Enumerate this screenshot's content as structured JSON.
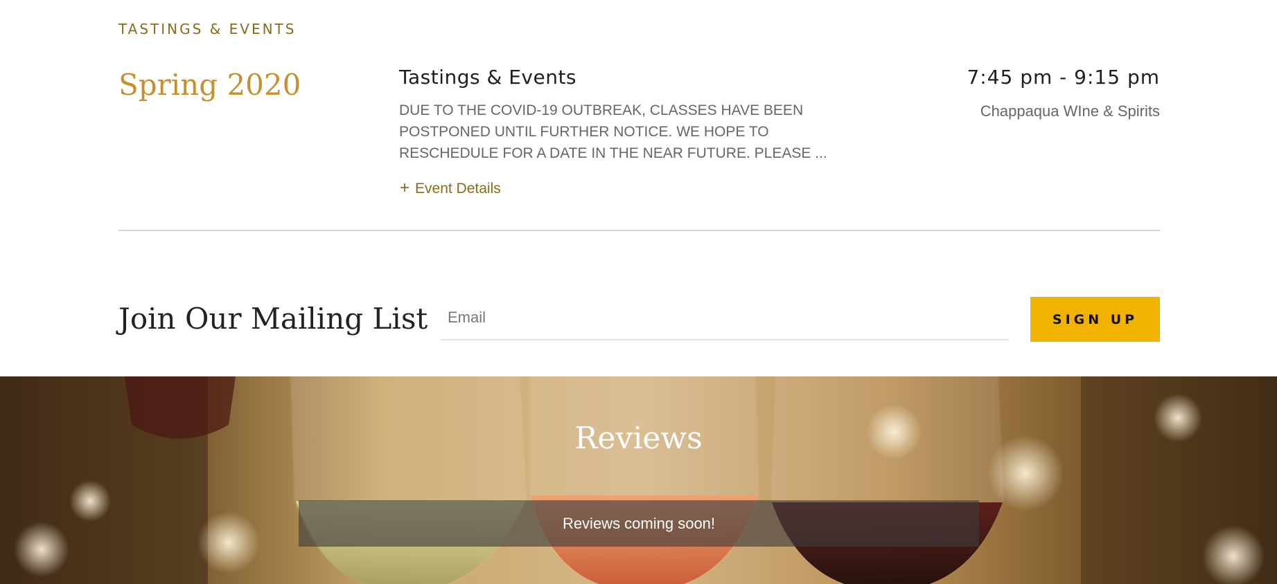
{
  "section": {
    "eyebrow": "TASTINGS & EVENTS"
  },
  "event": {
    "season": "Spring 2020",
    "title": "Tastings & Events",
    "description": "DUE TO THE COVID-19 OUTBREAK, CLASSES HAVE BEEN POSTPONED UNTIL FURTHER NOTICE. WE HOPE TO RESCHEDULE FOR A DATE IN THE NEAR FUTURE. PLEASE ...",
    "details_icon": "plus-icon",
    "details_label": "Event Details",
    "time": "7:45 pm - 9:15 pm",
    "location": "Chappaqua WIne & Spirits"
  },
  "mailing": {
    "heading": "Join Our Mailing List",
    "email_placeholder": "Email",
    "signup_label": "SIGN UP"
  },
  "reviews": {
    "title": "Reviews",
    "message": "Reviews coming soon!"
  },
  "colors": {
    "accent_gold": "#c7902f",
    "link_brown": "#8c6a1c",
    "button_yellow": "#f2b200"
  }
}
